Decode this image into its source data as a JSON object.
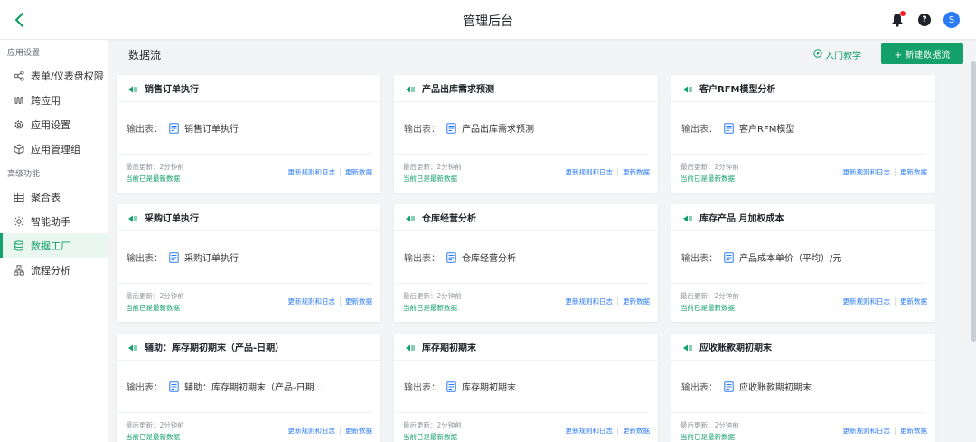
{
  "header": {
    "title": "管理后台",
    "avatar_letter": "S"
  },
  "sidebar": {
    "sections": [
      {
        "title": "应用设置"
      },
      {
        "title": "高级功能"
      }
    ],
    "items": [
      {
        "label": "表单/仪表盘权限",
        "icon": "share-nodes-icon"
      },
      {
        "label": "跨应用",
        "icon": "cross-app-icon"
      },
      {
        "label": "应用设置",
        "icon": "gear-icon"
      },
      {
        "label": "应用管理组",
        "icon": "cube-icon"
      },
      {
        "label": "聚合表",
        "icon": "table-icon"
      },
      {
        "label": "智能助手",
        "icon": "bulb-icon"
      },
      {
        "label": "数据工厂",
        "icon": "database-icon"
      },
      {
        "label": "流程分析",
        "icon": "flow-tree-icon"
      }
    ],
    "active_item": "数据工厂"
  },
  "page": {
    "title": "数据流",
    "tutorial_label": "入门教学",
    "new_button_label": "+ 新建数据流"
  },
  "card_labels": {
    "output_label": "输出表：",
    "updated_text": "最后更新：2分钟前",
    "fresh_text": "当前已是最新数据",
    "rules_log_link": "更新规则和日志",
    "update_data_link": "更新数据"
  },
  "cards": [
    {
      "name": "销售订单执行",
      "output": "销售订单执行"
    },
    {
      "name": "产品出库需求预测",
      "output": "产品出库需求预测"
    },
    {
      "name": "客户RFM模型分析",
      "output": "客户RFM模型"
    },
    {
      "name": "采购订单执行",
      "output": "采购订单执行"
    },
    {
      "name": "仓库经营分析",
      "output": "仓库经营分析"
    },
    {
      "name": "库存产品 月加权成本",
      "output": "产品成本单价（平均）/元"
    },
    {
      "name": "辅助：库存期初期末（产品-日期）",
      "output": "辅助：库存期初期末（产品-日期..."
    },
    {
      "name": "库存期初期末",
      "output": "库存期初期末"
    },
    {
      "name": "应收账款期初期末",
      "output": "应收账款期初期末"
    }
  ],
  "colors": {
    "accent": "#14a06a",
    "link": "#2b7bf6",
    "notification": "#f5222d"
  }
}
